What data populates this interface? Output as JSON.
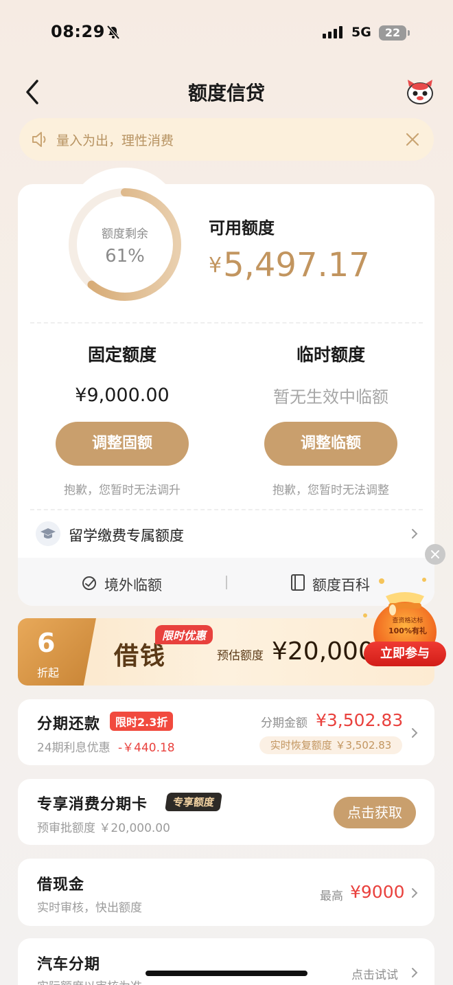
{
  "status_bar": {
    "time": "08:29",
    "network": "5G",
    "battery": "22"
  },
  "nav": {
    "title": "额度信贷"
  },
  "notice": {
    "text": "量入为出，理性消费"
  },
  "quota": {
    "ring_label": "额度剩余",
    "ring_percent_text": "61%",
    "remaining_fraction": 0.61,
    "available_label": "可用额度",
    "available_currency": "¥",
    "available_amount": "5,497.17",
    "fixed": {
      "title": "固定额度",
      "amount": "¥9,000.00",
      "button": "调整固额",
      "note": "抱歉，您暂时无法调升"
    },
    "temporary": {
      "title": "临时额度",
      "status": "暂无生效中临额",
      "button": "调整临额",
      "note": "抱歉，您暂时无法调整"
    },
    "study_abroad": "留学缴费专属额度",
    "footer_links": [
      "境外临额",
      "额度百科"
    ]
  },
  "promo": {
    "discount_number": "6",
    "discount_suffix": "折起",
    "headline": "借钱",
    "tag": "限时优惠",
    "estimate_label": "预估额度",
    "estimate_amount": "¥20,000",
    "bag_line1": "查资格达标",
    "bag_line2": "100%有礼",
    "join_button": "立即参与"
  },
  "installment": {
    "title": "分期还款",
    "tag": "限时2.3折",
    "sub_prefix": "24期利息优惠",
    "sub_amount": "-￥440.18",
    "amount_label": "分期金额",
    "amount": "¥3,502.83",
    "recover_label": "实时恢复额度",
    "recover_amount": "￥3,502.83"
  },
  "card_exclusive": {
    "title": "专享消费分期卡",
    "tag": "专享额度",
    "sub": "预审批额度 ￥20,000.00",
    "button": "点击获取"
  },
  "cash_loan": {
    "title": "借现金",
    "sub": "实时审核，快出额度",
    "max_label": "最高",
    "max_amount": "¥9000"
  },
  "car_loan": {
    "title": "汽车分期",
    "sub": "实际额度以审核为准",
    "action": "点击试试"
  },
  "colors": {
    "gold": "#c99f6d",
    "gold_text": "#c2955f",
    "red": "#e9413d"
  }
}
